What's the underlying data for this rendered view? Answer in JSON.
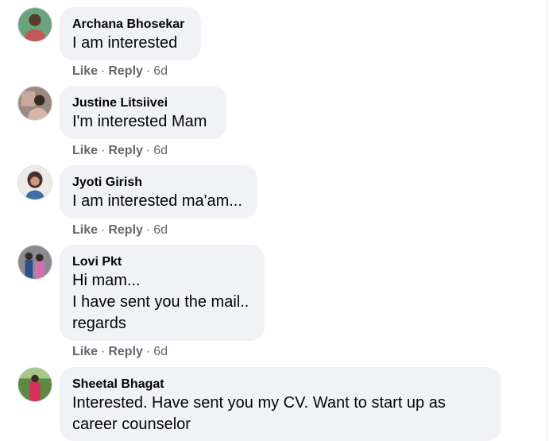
{
  "comments": [
    {
      "author": "Archana Bhosekar",
      "text": "I am interested",
      "like_label": "Like",
      "reply_label": "Reply",
      "time": "6d",
      "avatar": {
        "bg": "#6aa37e",
        "fg": "#c25a5a"
      }
    },
    {
      "author": "Justine Litsiivei",
      "text": "I'm interested Mam",
      "like_label": "Like",
      "reply_label": "Reply",
      "time": "6d",
      "avatar": {
        "bg": "#9a8a82",
        "fg": "#d8b7a6"
      }
    },
    {
      "author": "Jyoti Girish",
      "text": "I am interested ma'am...",
      "like_label": "Like",
      "reply_label": "Reply",
      "time": "6d",
      "avatar": {
        "bg": "#ecebe8",
        "fg": "#4a2f2a"
      }
    },
    {
      "author": "Lovi Pkt",
      "text": "Hi mam...\nI have sent you the mail..\nregards",
      "like_label": "Like",
      "reply_label": "Reply",
      "time": "6d",
      "avatar": {
        "bg": "#8b8a8f",
        "fg": "#d46fb1"
      }
    },
    {
      "author": "Sheetal Bhagat",
      "text": "Interested. Have sent you my CV. Want to start up as\ncareer counselor",
      "like_label": "Like",
      "reply_label": "Reply",
      "time": "",
      "avatar": {
        "bg": "#5d8a43",
        "fg": "#d8325b"
      }
    }
  ],
  "separator": "·"
}
